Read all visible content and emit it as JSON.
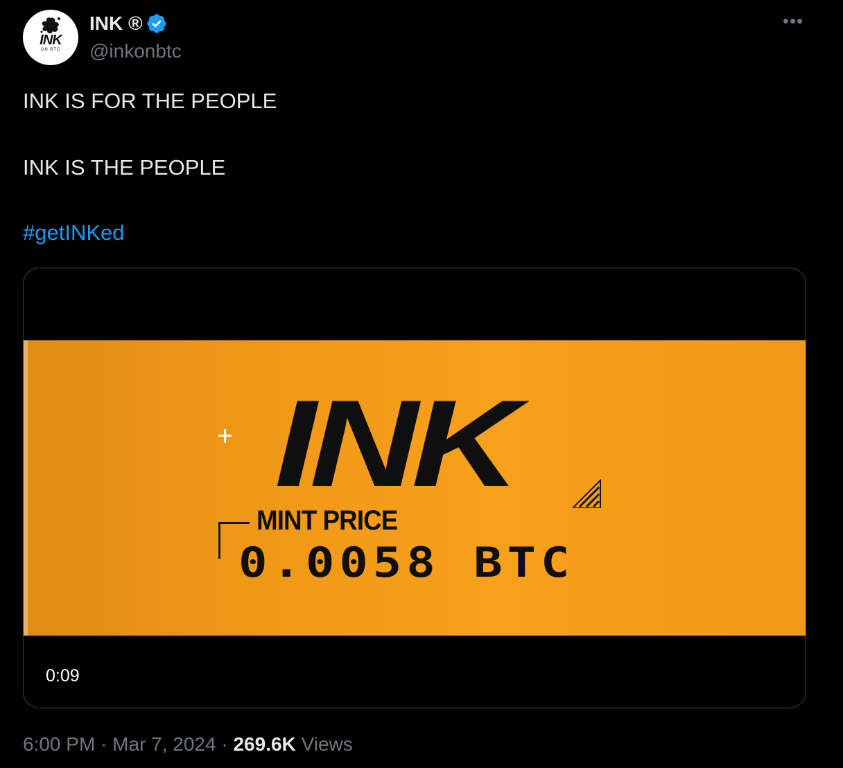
{
  "author": {
    "display_name": "INK ®",
    "handle": "@inkonbtc",
    "avatar_logo": "INK",
    "avatar_subtext": "ON BTC",
    "verified_color": "#1d9bf0"
  },
  "more_icon": "•••",
  "tweet": {
    "line1": "INK IS FOR THE PEOPLE",
    "line2": "INK IS THE PEOPLE",
    "hashtag": "#getINKed"
  },
  "media": {
    "title": "INK",
    "mint_label": "MINT PRICE",
    "price": "0.0058 BTC",
    "plus": "+",
    "duration": "0:09",
    "accent": "#f7a01c"
  },
  "footer": {
    "time": "6:00 PM",
    "sep1": "·",
    "date": "Mar 7, 2024",
    "sep2": "·",
    "views_count": "269.6K",
    "views_label": "Views"
  }
}
